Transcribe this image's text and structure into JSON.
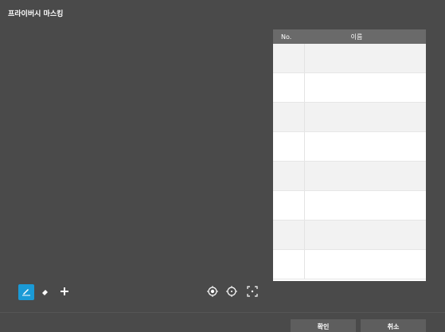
{
  "window": {
    "title": "프라이버시 마스킹"
  },
  "table": {
    "headers": {
      "no": "No.",
      "name": "이름"
    },
    "rows": [
      {
        "no": "",
        "name": ""
      },
      {
        "no": "",
        "name": ""
      },
      {
        "no": "",
        "name": ""
      },
      {
        "no": "",
        "name": ""
      },
      {
        "no": "",
        "name": ""
      },
      {
        "no": "",
        "name": ""
      },
      {
        "no": "",
        "name": ""
      },
      {
        "no": "",
        "name": ""
      }
    ]
  },
  "tools": {
    "draw": "draw-icon",
    "erase": "eraser-icon",
    "move": "move-icon",
    "center": "target-filled-icon",
    "locate": "target-icon",
    "fit": "fit-screen-icon"
  },
  "footer": {
    "ok_label": "확인",
    "cancel_label": "취소"
  },
  "colors": {
    "background": "#4a4a4a",
    "accent": "#1a9ad6",
    "header": "#6a6a6a"
  }
}
